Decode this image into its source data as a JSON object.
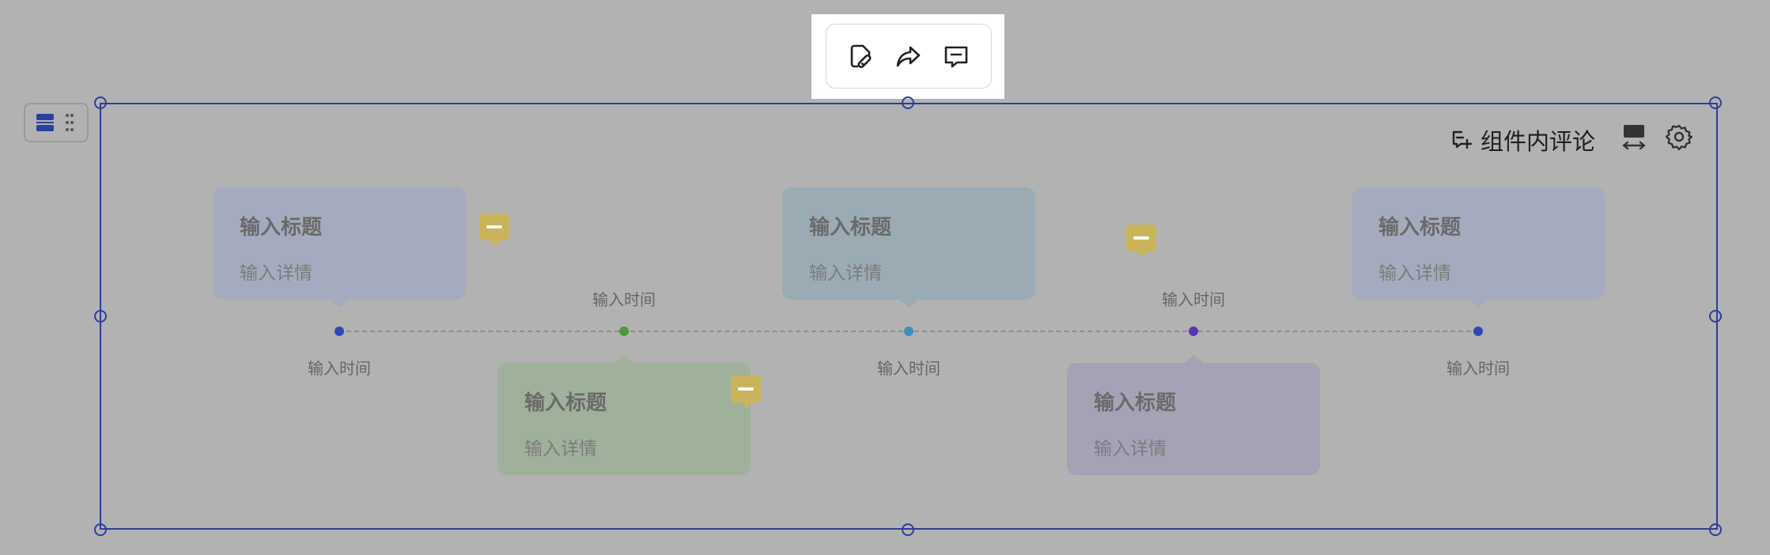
{
  "toolbar": {
    "buttons": [
      {
        "icon": "link-doc-icon"
      },
      {
        "icon": "share-icon"
      },
      {
        "icon": "comment-icon"
      }
    ]
  },
  "header": {
    "comment_label": "组件内评论"
  },
  "timeline": {
    "nodes": [
      {
        "time": "输入时间",
        "title": "输入标题",
        "detail": "输入详情",
        "color": "#a5abbe",
        "dot": "#2f47b8"
      },
      {
        "time": "输入时间",
        "title": "输入标题",
        "detail": "输入详情",
        "color": "#9fb19a",
        "dot": "#4a9a3a"
      },
      {
        "time": "输入时间",
        "title": "输入标题",
        "detail": "输入详情",
        "color": "#9aabb4",
        "dot": "#3a8fc0"
      },
      {
        "time": "输入时间",
        "title": "输入标题",
        "detail": "输入详情",
        "color": "#a6a2b6",
        "dot": "#5a35b0"
      },
      {
        "time": "输入时间",
        "title": "输入标题",
        "detail": "输入详情",
        "color": "#a5abbe",
        "dot": "#2f47b8"
      }
    ]
  },
  "colors": {
    "selection": "#2c3f9a",
    "comment_marker": "#c9b45a",
    "overlay": "#b2b2b2"
  }
}
